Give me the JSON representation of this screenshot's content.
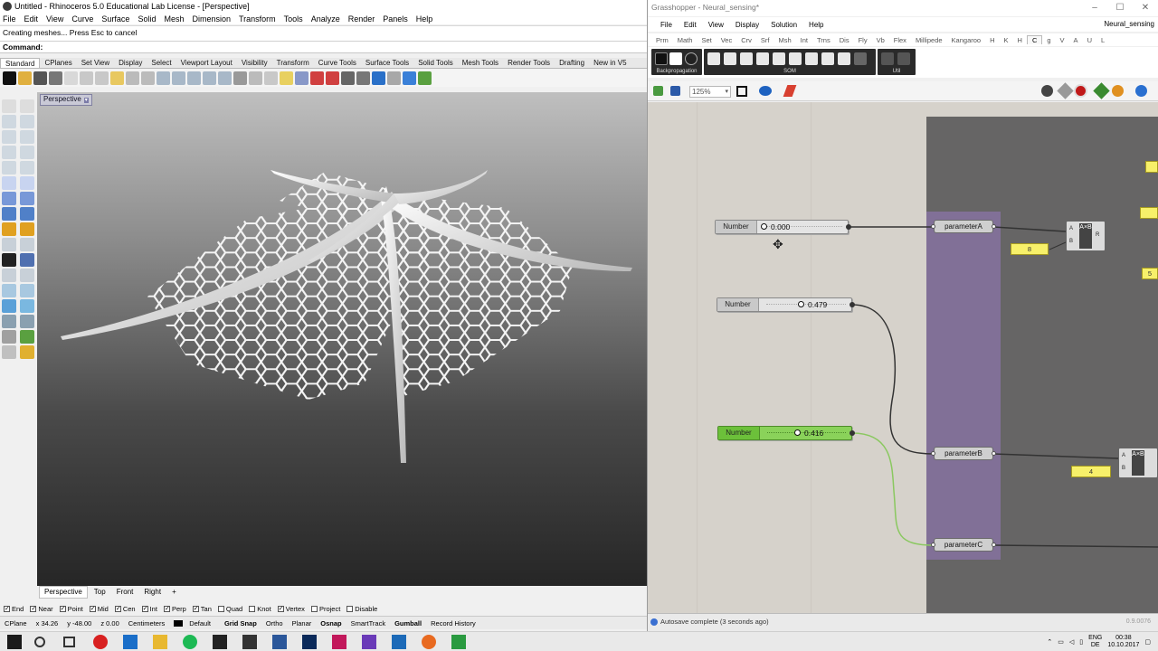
{
  "rhino": {
    "title": "Untitled - Rhinoceros 5.0 Educational Lab License - [Perspective]",
    "menu": [
      "File",
      "Edit",
      "View",
      "Curve",
      "Surface",
      "Solid",
      "Mesh",
      "Dimension",
      "Transform",
      "Tools",
      "Analyze",
      "Render",
      "Panels",
      "Help"
    ],
    "command_history": "Creating meshes... Press Esc to cancel",
    "command_prompt": "Command:",
    "toolbar_tabs": [
      "Standard",
      "CPlanes",
      "Set View",
      "Display",
      "Select",
      "Viewport Layout",
      "Visibility",
      "Transform",
      "Curve Tools",
      "Surface Tools",
      "Solid Tools",
      "Mesh Tools",
      "Render Tools",
      "Drafting",
      "New in V5"
    ],
    "viewport_label": "Perspective",
    "viewport_tabs": [
      "Perspective",
      "Top",
      "Front",
      "Right"
    ],
    "viewport_tab_add": "+",
    "osnaps": [
      {
        "label": "End",
        "checked": true
      },
      {
        "label": "Near",
        "checked": true
      },
      {
        "label": "Point",
        "checked": true
      },
      {
        "label": "Mid",
        "checked": true
      },
      {
        "label": "Cen",
        "checked": true
      },
      {
        "label": "Int",
        "checked": true
      },
      {
        "label": "Perp",
        "checked": true
      },
      {
        "label": "Tan",
        "checked": true
      },
      {
        "label": "Quad",
        "checked": false
      },
      {
        "label": "Knot",
        "checked": false
      },
      {
        "label": "Vertex",
        "checked": true
      },
      {
        "label": "Project",
        "checked": false
      },
      {
        "label": "Disable",
        "checked": false
      }
    ],
    "status": {
      "cplane": "CPlane",
      "x": "x 34.26",
      "y": "y -48.00",
      "z": "z 0.00",
      "units": "Centimeters",
      "layer": "Default",
      "grid_snap": "Grid Snap",
      "ortho": "Ortho",
      "planar": "Planar",
      "osnap": "Osnap",
      "smarttrack": "SmartTrack",
      "gumball": "Gumball",
      "record_history": "Record History"
    }
  },
  "grasshopper": {
    "title": "Grasshopper - Neural_sensing*",
    "doc_name": "Neural_sensing",
    "menu": [
      "File",
      "Edit",
      "View",
      "Display",
      "Solution",
      "Help"
    ],
    "tabs": [
      "Prm",
      "Math",
      "Set",
      "Vec",
      "Crv",
      "Srf",
      "Msh",
      "Int",
      "Trns",
      "Dis",
      "Fly",
      "Vb",
      "Flex",
      "Millipede",
      "Kangaroo",
      "H",
      "K",
      "H",
      "C",
      "g",
      "V",
      "A",
      "U",
      "L"
    ],
    "active_tab": "C",
    "ribbon_groups": [
      "Backpropagation",
      "SOM",
      "Util"
    ],
    "zoom": "125%",
    "sliders": [
      {
        "name": "Number",
        "value": "0.000",
        "fraction": 0.0
      },
      {
        "name": "Number",
        "value": "0.479",
        "fraction": 0.479
      },
      {
        "name": "Number",
        "value": "0.416",
        "fraction": 0.416
      }
    ],
    "params": [
      "parameterA",
      "parameterB",
      "parameterC"
    ],
    "panels": [
      "8",
      "4",
      "5"
    ],
    "comp_label": "A×B",
    "status": "Autosave complete (3 seconds ago)",
    "version": "0.9.0076"
  },
  "taskbar": {
    "lang_top": "ENG",
    "lang_bottom": "DE",
    "time": "00:38",
    "date": "10.10.2017"
  },
  "colors": {
    "slider_active": "#8ad25a",
    "group_fill": "#8672a0",
    "panel_yellow": "#f7f06a",
    "canvas": "#d6d2cb"
  }
}
